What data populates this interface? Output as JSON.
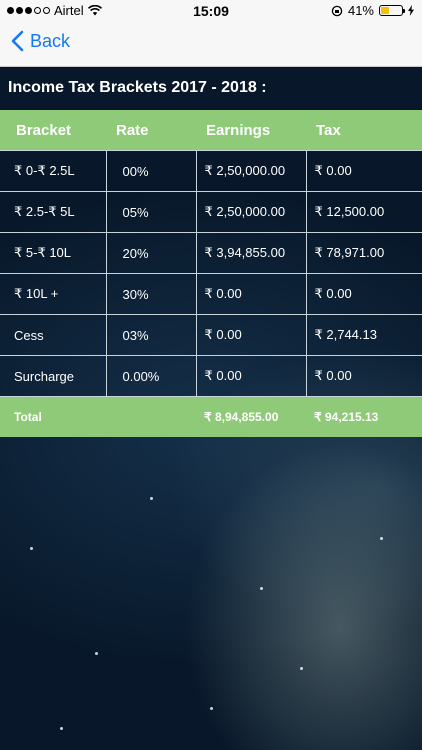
{
  "status": {
    "carrier": "Airtel",
    "time": "15:09",
    "battery": "41%",
    "battery_level": 0.41
  },
  "nav": {
    "back_label": "Back"
  },
  "page": {
    "title": "Income Tax Brackets 2017 - 2018 :"
  },
  "table": {
    "headers": [
      "Bracket",
      "Rate",
      "Earnings",
      "Tax"
    ],
    "rows": [
      [
        "₹ 0-₹ 2.5L",
        "00%",
        "₹ 2,50,000.00",
        "₹ 0.00"
      ],
      [
        "₹ 2.5-₹ 5L",
        "05%",
        "₹ 2,50,000.00",
        "₹ 12,500.00"
      ],
      [
        "₹ 5-₹ 10L",
        "20%",
        "₹ 3,94,855.00",
        "₹ 78,971.00"
      ],
      [
        "₹ 10L +",
        "30%",
        "₹ 0.00",
        "₹ 0.00"
      ],
      [
        "Cess",
        "03%",
        "₹ 0.00",
        "₹ 2,744.13"
      ],
      [
        "Surcharge",
        "0.00%",
        "₹ 0.00",
        "₹ 0.00"
      ]
    ],
    "total": {
      "label": "Total",
      "earnings": "₹ 8,94,855.00",
      "tax": "₹ 94,215.13"
    }
  },
  "colors": {
    "accent": "#1478f6",
    "header_green": "#8fca78",
    "battery": "#f2c200"
  }
}
